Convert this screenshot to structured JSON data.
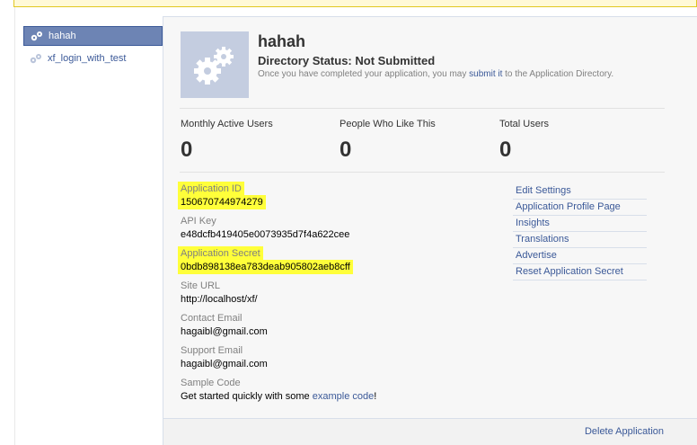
{
  "sidebar": {
    "items": [
      {
        "label": "hahah",
        "active": true
      },
      {
        "label": "xf_login_with_test",
        "active": false
      }
    ]
  },
  "app": {
    "name": "hahah",
    "directory_status": "Directory Status: Not Submitted",
    "directory_desc_before": "Once you have completed your application, you may ",
    "directory_link": "submit it",
    "directory_desc_after": " to the Application Directory."
  },
  "stats": [
    {
      "label": "Monthly Active Users",
      "value": "0"
    },
    {
      "label": "People Who Like This",
      "value": "0"
    },
    {
      "label": "Total Users",
      "value": "0"
    }
  ],
  "fields": {
    "app_id": {
      "label": "Application ID",
      "value": "150670744974279"
    },
    "api_key": {
      "label": "API Key",
      "value": "e48dcfb419405e0073935d7f4a622cee"
    },
    "app_secret": {
      "label": "Application Secret",
      "value": "0bdb898138ea783deab905802aeb8cff"
    },
    "site_url": {
      "label": "Site URL",
      "value": "http://localhost/xf/"
    },
    "contact_email": {
      "label": "Contact Email",
      "value": "hagaibl@gmail.com"
    },
    "support_email": {
      "label": "Support Email",
      "value": "hagaibl@gmail.com"
    },
    "sample_code": {
      "label": "Sample Code",
      "value_before": "Get started quickly with some ",
      "link": "example code",
      "value_after": "!"
    }
  },
  "actions": [
    "Edit Settings",
    "Application Profile Page",
    "Insights",
    "Translations",
    "Advertise",
    "Reset Application Secret"
  ],
  "footer": {
    "delete_label": "Delete Application"
  },
  "colors": {
    "link": "#3b5998",
    "highlight": "#ffff3a",
    "sidebar_active": "#6d84b4",
    "icon_bg": "#c4cde0"
  },
  "icons": {
    "app": "gears-icon",
    "sidebar": "gears-icon"
  }
}
